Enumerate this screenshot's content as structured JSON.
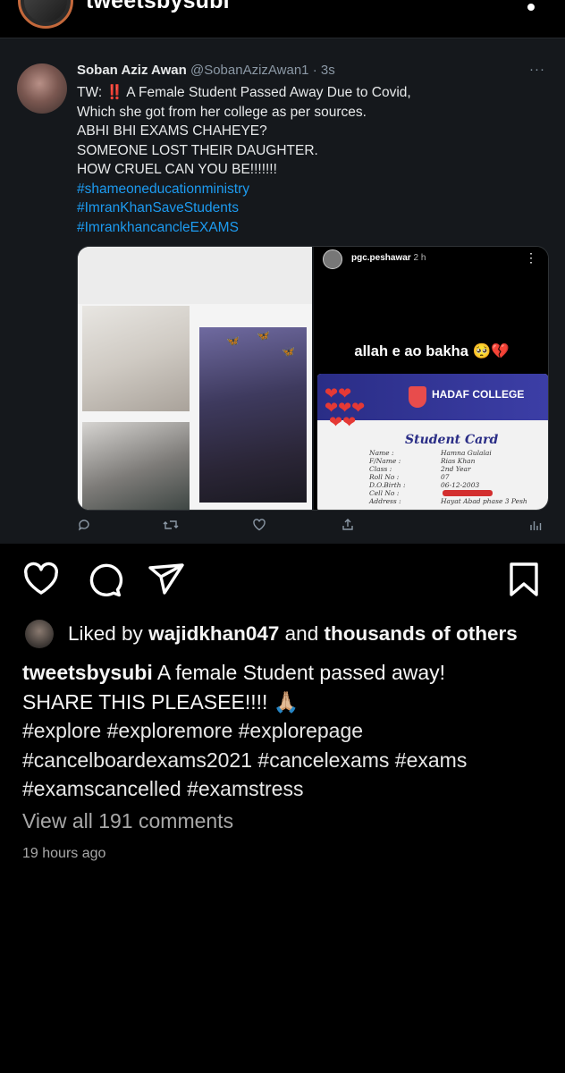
{
  "header": {
    "username": "tweetsbysubi"
  },
  "tweet": {
    "name": "Soban Aziz Awan",
    "handle": "@SobanAzizAwan1",
    "time": "· 3s",
    "more": "···",
    "lines": [
      "A Female Student Passed Away Due to Covid,",
      "Which she got from her college as per sources.",
      "ABHI BHI EXAMS CHAHEYE?",
      "SOMEONE LOST THEIR DAUGHTER.",
      "HOW CRUEL CAN YOU BE!!!!!!!"
    ],
    "tw_prefix": "TW:",
    "tw_emoji": "‼️",
    "hashtags": [
      "#shameoneducationministry",
      "#ImranKhanSaveStudents",
      "#ImrankhancancleEXAMS"
    ],
    "story": {
      "user": "pgc.peshawar",
      "time": "2 h",
      "caption": "allah e ao bakha 🥺💔",
      "card": {
        "college": "HADAF COLLEGE",
        "title": "Student Card",
        "fields": [
          "Name :",
          "F/Name :",
          "Class :",
          "Roll No :",
          "D.O.Birth :",
          "Cell No :",
          "Address :"
        ],
        "values": [
          "Hamna Gulalai",
          "Rias Khan",
          "2nd Year",
          "07",
          "06-12-2003",
          "",
          "Hayat Abad phase 3 Pesh"
        ]
      }
    }
  },
  "post": {
    "liked_by_prefix": "Liked by",
    "liked_by_user": "wajidkhan047",
    "liked_by_and": "and",
    "liked_by_others": "thousands of others",
    "caption_user": "tweetsbysubi",
    "caption_line1": "A female Student passed away!",
    "caption_line2": "SHARE THIS PLEASEE!!!! 🙏🏼",
    "caption_line3": "#explore #exploremore #explorepage",
    "caption_line4": "#cancelboardexams2021 #cancelexams #exams",
    "caption_line5": "#examscancelled #examstress",
    "view_all": "View all 191 comments",
    "time_ago": "19 hours ago"
  }
}
